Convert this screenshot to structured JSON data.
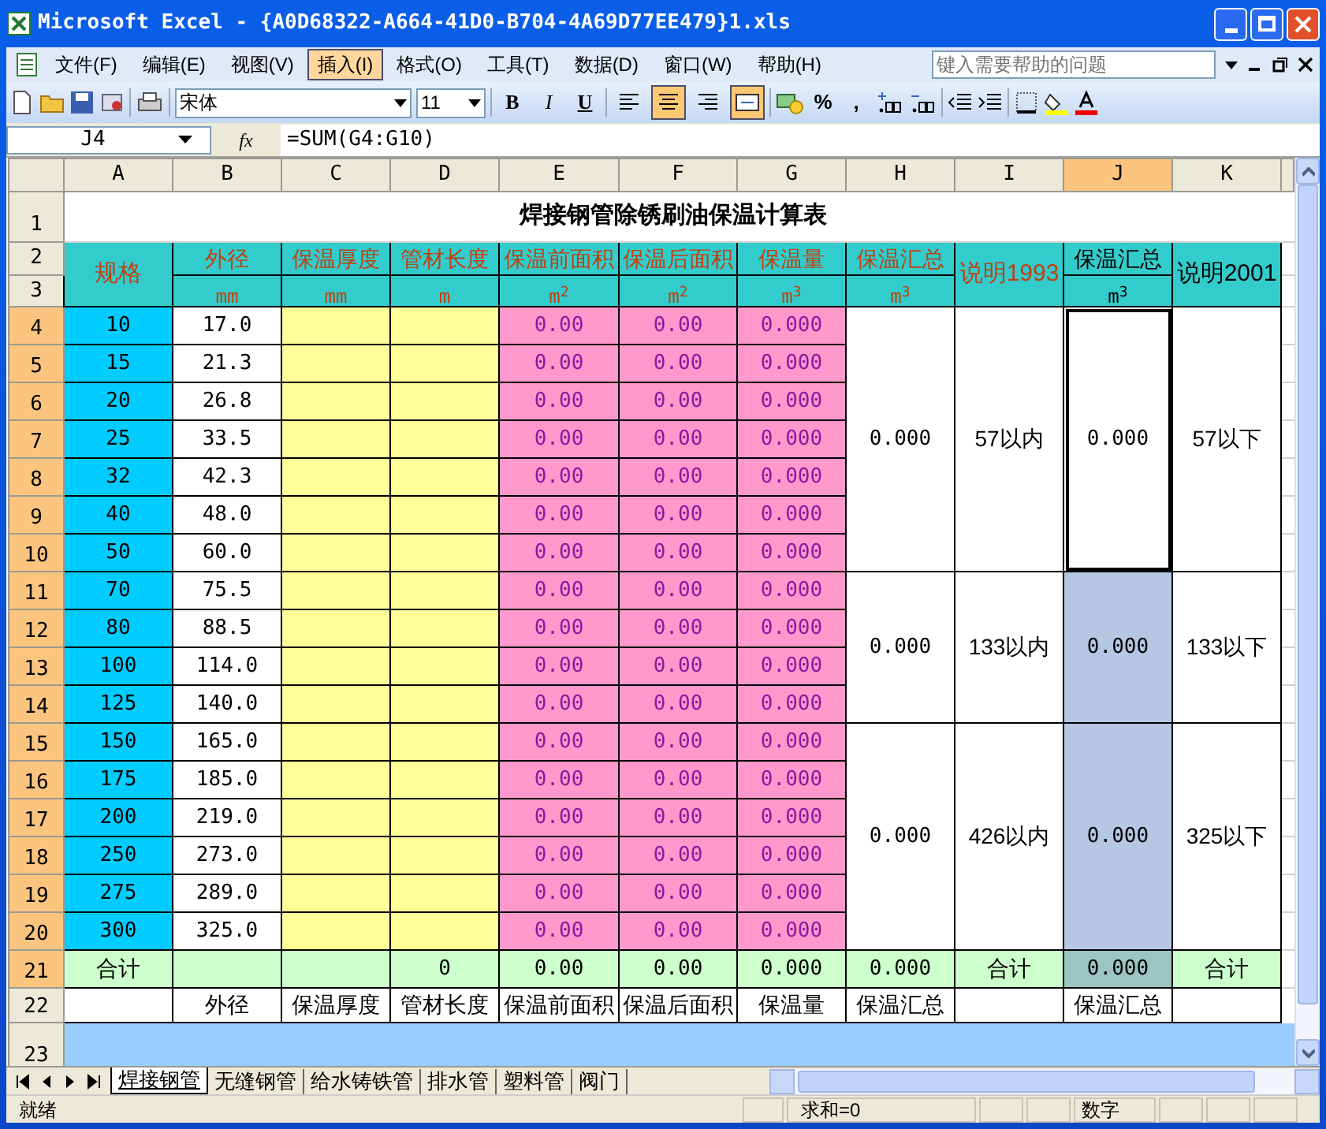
{
  "window": {
    "title": "Microsoft Excel - {A0D68322-A664-41D0-B704-4A69D77EE479}1.xls"
  },
  "menu": [
    {
      "label": "文件(F)",
      "selected": false
    },
    {
      "label": "编辑(E)",
      "selected": false
    },
    {
      "label": "视图(V)",
      "selected": false
    },
    {
      "label": "插入(I)",
      "selected": true
    },
    {
      "label": "格式(O)",
      "selected": false
    },
    {
      "label": "工具(T)",
      "selected": false
    },
    {
      "label": "数据(D)",
      "selected": false
    },
    {
      "label": "窗口(W)",
      "selected": false
    },
    {
      "label": "帮助(H)",
      "selected": false
    }
  ],
  "help_box": {
    "placeholder": "键入需要帮助的问题"
  },
  "toolbar": {
    "font": "宋体",
    "font_size": "11",
    "styles": [
      "B",
      "I",
      "U"
    ],
    "alignment": [
      {
        "kind": "left",
        "selected": false
      },
      {
        "kind": "center",
        "selected": true
      },
      {
        "kind": "right",
        "selected": false
      },
      {
        "kind": "merge",
        "selected": true
      }
    ],
    "number_formats": [
      "%",
      ","
    ]
  },
  "formula_bar": {
    "name_box": "J4",
    "fx": "fx",
    "formula": "=SUM(G4:G10)"
  },
  "columns": [
    {
      "label": "A",
      "selected": false
    },
    {
      "label": "B",
      "selected": false
    },
    {
      "label": "C",
      "selected": false
    },
    {
      "label": "D",
      "selected": false
    },
    {
      "label": "E",
      "selected": false
    },
    {
      "label": "F",
      "selected": false
    },
    {
      "label": "G",
      "selected": false
    },
    {
      "label": "H",
      "selected": false
    },
    {
      "label": "I",
      "selected": false
    },
    {
      "label": "J",
      "selected": true
    },
    {
      "label": "K",
      "selected": false
    }
  ],
  "row_headers": [
    {
      "label": "1",
      "selected": false
    },
    {
      "label": "2",
      "selected": false
    },
    {
      "label": "3",
      "selected": false
    },
    {
      "label": "4",
      "selected": true
    },
    {
      "label": "5",
      "selected": true
    },
    {
      "label": "6",
      "selected": true
    },
    {
      "label": "7",
      "selected": true
    },
    {
      "label": "8",
      "selected": true
    },
    {
      "label": "9",
      "selected": true
    },
    {
      "label": "10",
      "selected": true
    },
    {
      "label": "11",
      "selected": true
    },
    {
      "label": "12",
      "selected": true
    },
    {
      "label": "13",
      "selected": true
    },
    {
      "label": "14",
      "selected": true
    },
    {
      "label": "15",
      "selected": true
    },
    {
      "label": "16",
      "selected": true
    },
    {
      "label": "17",
      "selected": true
    },
    {
      "label": "18",
      "selected": true
    },
    {
      "label": "19",
      "selected": true
    },
    {
      "label": "20",
      "selected": true
    },
    {
      "label": "21",
      "selected": true
    },
    {
      "label": "22",
      "selected": false
    },
    {
      "label": "23",
      "selected": false
    }
  ],
  "sheet": {
    "title": "焊接钢管除锈刷油保温计算表",
    "header": [
      {
        "label": "规格",
        "color": "#c0400f"
      },
      {
        "label": "外径",
        "unit": "mm",
        "color": "#c0400f"
      },
      {
        "label": "保温厚度",
        "unit": "mm",
        "color": "#c0400f"
      },
      {
        "label": "管材长度",
        "unit": "m",
        "color": "#c0400f"
      },
      {
        "label": "保温前面积",
        "unit": "m$^{2}$",
        "color": "#c0400f"
      },
      {
        "label": "保温后面积",
        "unit": "m$^{2}$",
        "color": "#c0400f"
      },
      {
        "label": "保温量",
        "unit": "m$^{3}$",
        "color": "#c0400f"
      },
      {
        "label": "保温汇总",
        "unit": "m$^{3}$",
        "color": "#c0400f"
      },
      {
        "label": "说明1993",
        "color": "#c0400f"
      },
      {
        "label": "保温汇总",
        "unit": "m$^{3}$",
        "color": "#000000"
      },
      {
        "label": "说明2001",
        "color": "#000000"
      }
    ],
    "groups": [
      {
        "total": "0.000",
        "note_1993": "57以内",
        "j_total": "0.000",
        "j_selected": false,
        "active": true,
        "note_2001": "57以下",
        "rows": [
          {
            "spec": "10",
            "od": "17.0",
            "area_before": "0.00",
            "area_after": "0.00",
            "volume": "0.000"
          },
          {
            "spec": "15",
            "od": "21.3",
            "area_before": "0.00",
            "area_after": "0.00",
            "volume": "0.000"
          },
          {
            "spec": "20",
            "od": "26.8",
            "area_before": "0.00",
            "area_after": "0.00",
            "volume": "0.000"
          },
          {
            "spec": "25",
            "od": "33.5",
            "area_before": "0.00",
            "area_after": "0.00",
            "volume": "0.000"
          },
          {
            "spec": "32",
            "od": "42.3",
            "area_before": "0.00",
            "area_after": "0.00",
            "volume": "0.000"
          },
          {
            "spec": "40",
            "od": "48.0",
            "area_before": "0.00",
            "area_after": "0.00",
            "volume": "0.000"
          },
          {
            "spec": "50",
            "od": "60.0",
            "area_before": "0.00",
            "area_after": "0.00",
            "volume": "0.000"
          }
        ]
      },
      {
        "total": "0.000",
        "note_1993": "133以内",
        "j_total": "0.000",
        "j_selected": true,
        "active": false,
        "note_2001": "133以下",
        "rows": [
          {
            "spec": "70",
            "od": "75.5",
            "area_before": "0.00",
            "area_after": "0.00",
            "volume": "0.000"
          },
          {
            "spec": "80",
            "od": "88.5",
            "area_before": "0.00",
            "area_after": "0.00",
            "volume": "0.000"
          },
          {
            "spec": "100",
            "od": "114.0",
            "area_before": "0.00",
            "area_after": "0.00",
            "volume": "0.000"
          },
          {
            "spec": "125",
            "od": "140.0",
            "area_before": "0.00",
            "area_after": "0.00",
            "volume": "0.000"
          }
        ]
      },
      {
        "total": "0.000",
        "note_1993": "426以内",
        "j_total": "0.000",
        "j_selected": true,
        "active": false,
        "note_2001": "325以下",
        "rows": [
          {
            "spec": "150",
            "od": "165.0",
            "area_before": "0.00",
            "area_after": "0.00",
            "volume": "0.000"
          },
          {
            "spec": "175",
            "od": "185.0",
            "area_before": "0.00",
            "area_after": "0.00",
            "volume": "0.000"
          },
          {
            "spec": "200",
            "od": "219.0",
            "area_before": "0.00",
            "area_after": "0.00",
            "volume": "0.000"
          },
          {
            "spec": "250",
            "od": "273.0",
            "area_before": "0.00",
            "area_after": "0.00",
            "volume": "0.000"
          },
          {
            "spec": "275",
            "od": "289.0",
            "area_before": "0.00",
            "area_after": "0.00",
            "volume": "0.000"
          },
          {
            "spec": "300",
            "od": "325.0",
            "area_before": "0.00",
            "area_after": "0.00",
            "volume": "0.000"
          }
        ]
      }
    ],
    "total_row": {
      "label": "合计",
      "length": "0",
      "area_before": "0.00",
      "area_after": "0.00",
      "volume": "0.000",
      "total": "0.000",
      "note_1993": "合计",
      "j_total": "0.000",
      "j_selected": true,
      "note_2001": "合计"
    },
    "labels_row": {
      "labels": [
        "外径",
        "保温厚度",
        "管材长度",
        "保温前面积",
        "保温后面积",
        "保温量",
        "保温汇总"
      ],
      "j_label": "保温汇总"
    }
  },
  "sheet_tabs": [
    {
      "label": "焊接钢管",
      "selected": true
    },
    {
      "label": "无缝钢管",
      "selected": false
    },
    {
      "label": "给水铸铁管",
      "selected": false
    },
    {
      "label": "排水管",
      "selected": false
    },
    {
      "label": "塑料管",
      "selected": false
    },
    {
      "label": "阀门",
      "selected": false
    }
  ],
  "status_bar": {
    "state": "就绪",
    "sum": "求和=0",
    "mode": "数字"
  }
}
